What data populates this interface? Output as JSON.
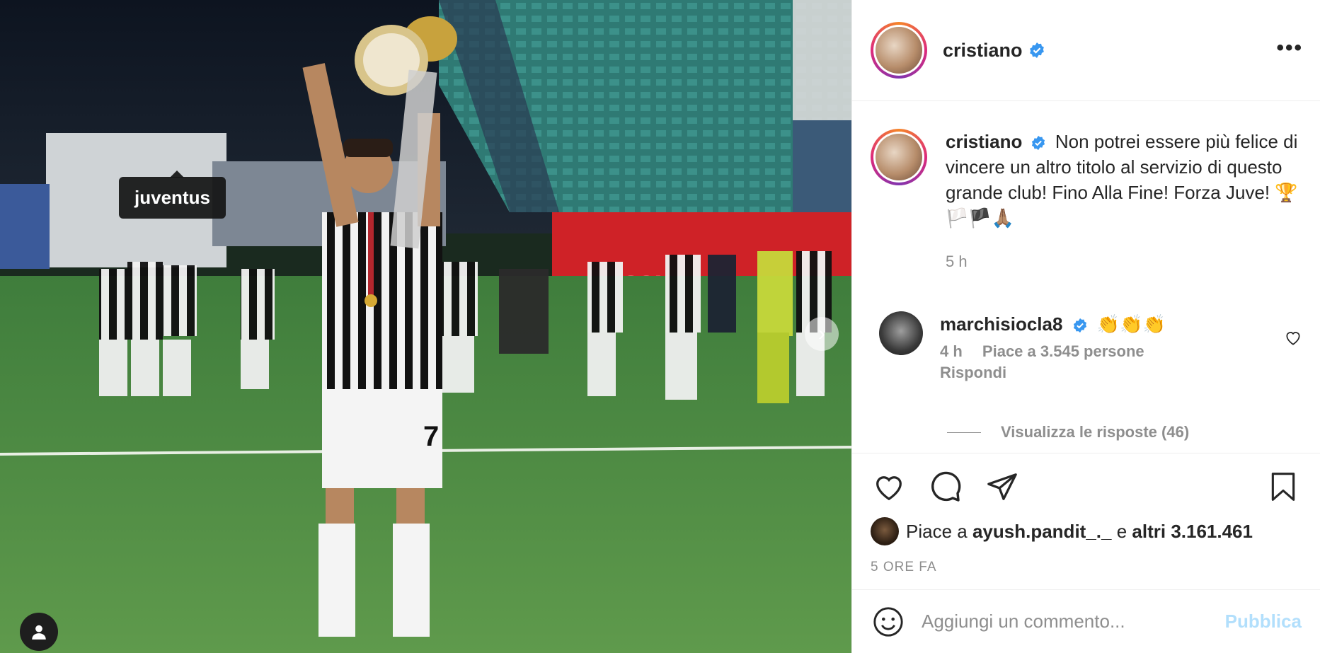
{
  "photo": {
    "tag_label": "juventus",
    "alt": ""
  },
  "header": {
    "username": "cristiano",
    "more_label": "•••"
  },
  "caption": {
    "username": "cristiano",
    "text": "Non potrei essere più felice di vincere un altro titolo al servizio di questo grande club! Fino Alla Fine! Forza Juve! 🏆🏳️🏴🙏🏽",
    "time": "5 h"
  },
  "comment": {
    "username": "marchisiocla8",
    "text": "👏👏👏",
    "time": "4 h",
    "likes": "Piace a 3.545 persone",
    "reply_label": "Rispondi",
    "view_replies": "Visualizza le risposte (46)"
  },
  "likes": {
    "prefix": "Piace a",
    "liker": "ayush.pandit_._",
    "middle": "e",
    "others": "altri 3.161.461"
  },
  "posted_ago": "5 ORE FA",
  "add_comment": {
    "placeholder": "Aggiungi un commento...",
    "publish_label": "Pubblica"
  },
  "colors": {
    "verified": "#3897f0",
    "muted": "#8e8e8e",
    "publish_disabled": "#b2dffc"
  }
}
